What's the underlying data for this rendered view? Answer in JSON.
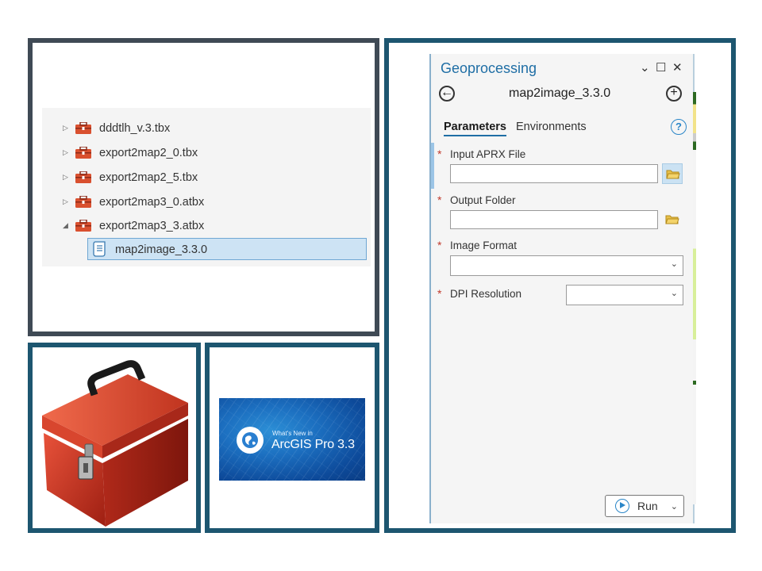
{
  "tree": {
    "cut_off_label": "_",
    "items": [
      {
        "label": "dddtlh_v.3.tbx",
        "expander": "▷"
      },
      {
        "label": "export2map2_0.tbx",
        "expander": "▷"
      },
      {
        "label": "export2map2_5.tbx",
        "expander": "▷"
      },
      {
        "label": "export2map3_0.atbx",
        "expander": "▷"
      },
      {
        "label": "export2map3_3.atbx",
        "expander": "◢"
      }
    ],
    "selected_child": {
      "label": "map2image_3.3.0",
      "icon": "script-icon"
    }
  },
  "arcgis_tile": {
    "subtitle": "What's New in",
    "title": "ArcGIS Pro 3.3",
    "icon": "arcgis-globe-icon"
  },
  "geoprocessing": {
    "pane_title": "Geoprocessing",
    "window_controls": {
      "menu": "⌄",
      "maximize": "☐",
      "close": "✕"
    },
    "back_glyph": "←",
    "add_glyph": "+",
    "tool_name": "map2image_3.3.0",
    "tabs": {
      "parameters": "Parameters",
      "environments": "Environments"
    },
    "help_glyph": "?",
    "required_marker": "*",
    "params": {
      "input_aprx": {
        "label": "Input APRX File",
        "value": ""
      },
      "output_folder": {
        "label": "Output Folder",
        "value": ""
      },
      "image_format": {
        "label": "Image Format",
        "value": ""
      },
      "dpi": {
        "label": "DPI Resolution",
        "value": ""
      }
    },
    "dropdown_glyph": "⌄",
    "run_label": "Run"
  },
  "colors": {
    "accent": "#1f6ea5",
    "frame_dark": "#3f4a55",
    "frame_teal": "#1d5670",
    "toolbox_red": "#c0392b",
    "required": "#c0392b"
  }
}
